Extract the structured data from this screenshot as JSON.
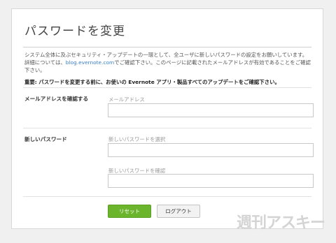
{
  "page": {
    "title": "パスワードを変更",
    "description_part1": "システム全体に及ぶセキュリティ・アップデートの一環として、全ユーザに新しいパスワードの設定をお願いしています。詳細については、",
    "description_link": "blog.evernote.com",
    "description_part2": "でご確認下さい。このページに記載されたメールアドレスが有効であることをご確認下さい。",
    "notice": "重要: パスワードを変更する前に、お使いの Evernote アプリ・製品すべてのアップデートをご確認下さい。"
  },
  "email_section": {
    "label": "メールアドレスを確認する",
    "field_label": "メールアドレス",
    "value": ""
  },
  "password_section": {
    "label": "新しいパスワード",
    "new_password_label": "新しいパスワードを選択",
    "confirm_password_label": "新しいパスワードを確認",
    "new_password_value": "",
    "confirm_password_value": ""
  },
  "buttons": {
    "reset": "リセット",
    "logout": "ログアウト"
  },
  "watermark": "週刊アスキー"
}
